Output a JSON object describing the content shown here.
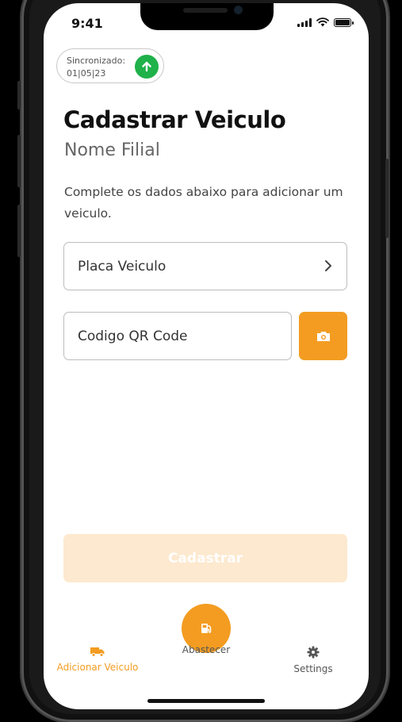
{
  "status_bar": {
    "time": "9:41"
  },
  "sync": {
    "label": "Sincronizado:",
    "date": "01|05|23",
    "status_color": "#1fb14a",
    "icon": "arrow-up-icon"
  },
  "header": {
    "title": "Cadastrar Veiculo",
    "subtitle": "Nome Filial",
    "description": "Complete os dados abaixo para adicionar um veiculo."
  },
  "form": {
    "plate_placeholder": "Placa Veiculo",
    "qr_placeholder": "Codigo QR Code",
    "camera_icon": "camera-icon",
    "submit_label": "Cadastrar"
  },
  "tab_bar": {
    "items": [
      {
        "label": "Adicionar Veiculo",
        "icon": "truck-icon",
        "active": true
      },
      {
        "label": "Abastecer",
        "icon": "fuel-icon",
        "active": false
      },
      {
        "label": "Settings",
        "icon": "gear-icon",
        "active": false
      }
    ]
  },
  "colors": {
    "accent": "#f39c21",
    "accent_disabled": "#fde9cf",
    "success": "#1fb14a"
  }
}
